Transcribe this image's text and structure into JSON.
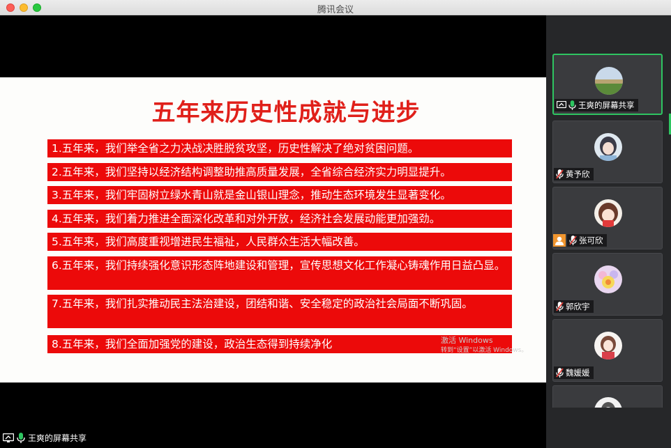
{
  "window": {
    "title": "腾讯会议"
  },
  "slide": {
    "title": "五年来历史性成就与进步",
    "items": [
      "1.五年来，我们举全省之力决战决胜脱贫攻坚，历史性解决了绝对贫困问题。",
      "2.五年来，我们坚持以经济结构调整助推高质量发展，全省综合经济实力明显提升。",
      "3.五年来，我们牢固树立绿水青山就是金山银山理念，推动生态环境发生显著变化。",
      "4.五年来，我们着力推进全面深化改革和对外开放，经济社会发展动能更加强劲。",
      "5.五年来，我们高度重视增进民生福祉，人民群众生活大幅改善。",
      "6.五年来，我们持续强化意识形态阵地建设和管理，宣传思想文化工作凝心铸魂作用日益凸显。",
      "7.五年来，我们扎实推动民主法治建设，团结和谐、安全稳定的政治社会局面不断巩固。",
      "8.五年来，我们全面加强党的建设，政治生态得到持续净化"
    ],
    "watermark": {
      "line1": "激活 Windows",
      "line2": "转到“设置”以激活 Windows。"
    }
  },
  "screen_share_label": "王爽的屏幕共享",
  "participants": [
    {
      "name": "王爽的屏幕共享",
      "mic": "on",
      "sharing": true,
      "active": true
    },
    {
      "name": "黄予欣",
      "mic": "muted"
    },
    {
      "name": "张可欣",
      "mic": "muted",
      "badge": "person-icon"
    },
    {
      "name": "郭欣宇",
      "mic": "muted"
    },
    {
      "name": "魏媛媛",
      "mic": "muted"
    }
  ],
  "colors": {
    "accent_green": "#2ec561",
    "slide_red": "#ec0a0a",
    "title_red": "#e0201a"
  }
}
